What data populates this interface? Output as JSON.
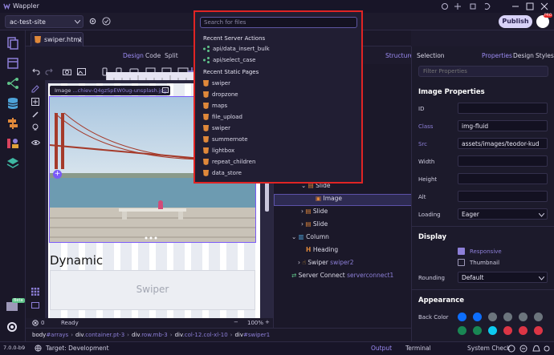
{
  "titlebar": {
    "app_name": "Wappler"
  },
  "toolbar": {
    "site": "ac-test-site",
    "publish_label": "Publish",
    "avatar_badge": "PRO"
  },
  "tabs": {
    "file_tab": "swiper.html"
  },
  "views": {
    "design": "Design",
    "code": "Code",
    "split": "Split",
    "structure": "Structure"
  },
  "image_toolbar": {
    "label": "Image",
    "file": "...chiev-Q4gzSpEW0ug-unsplash.jpg"
  },
  "canvas": {
    "heading": "Dynamic",
    "swiper_label": "Swiper"
  },
  "editor_status": {
    "errors": "0",
    "status": "Ready",
    "zoom": "100%"
  },
  "breadcrumb": [
    {
      "el": "body",
      "cls": "#arrays"
    },
    {
      "el": "div",
      "cls": ".container.pt-3"
    },
    {
      "el": "div",
      "cls": ".row.mb-3"
    },
    {
      "el": "div",
      "cls": ".col-12.col-xl-10"
    },
    {
      "el": "div",
      "cls": "#swiper1"
    }
  ],
  "structure": {
    "rows": [
      {
        "label": "Slide",
        "extra": ""
      },
      {
        "label": "Image",
        "extra": ""
      },
      {
        "label": "Slide",
        "extra": ""
      },
      {
        "label": "Slide",
        "extra": ""
      },
      {
        "label": "Column",
        "extra": ""
      },
      {
        "label": "Heading",
        "extra": ""
      },
      {
        "label": "Swiper",
        "extra": "swiper2"
      },
      {
        "label": "Server Connect",
        "extra": "serverconnect1"
      }
    ]
  },
  "right_panel": {
    "tab_selection": "Selection",
    "tab_properties": "Properties",
    "tab_design": "Design",
    "tab_styles": "Styles",
    "filter_placeholder": "Filter Properties",
    "section_image": "Image Properties",
    "labels": {
      "id": "ID",
      "class": "Class",
      "src": "Src",
      "width": "Width",
      "height": "Height",
      "alt": "Alt",
      "loading": "Loading"
    },
    "values": {
      "id": "",
      "class": "img-fluid",
      "src": "assets/images/teodor-kud",
      "width": "",
      "height": "",
      "alt": "",
      "loading": "Eager"
    },
    "section_display": "Display",
    "responsive_label": "Responsive",
    "responsive_checked": true,
    "thumbnail_label": "Thumbnail",
    "rounding_label": "Rounding",
    "rounding_value": "Default",
    "section_appearance": "Appearance",
    "back_color_label": "Back Color",
    "swatches": [
      "#0d6efd",
      "#0d6efd",
      "#6c757d",
      "#6c757d",
      "#6c757d",
      "#6c757d",
      "#198754",
      "#198754",
      "#0dcaf0",
      "#dc3545",
      "#dc3545",
      "#dc3545"
    ]
  },
  "popup": {
    "search_placeholder": "Search for files",
    "section_server": "Recent Server Actions",
    "server_actions": [
      "api/data_insert_bulk",
      "api/select_case"
    ],
    "section_pages": "Recent Static Pages",
    "pages": [
      "swiper",
      "dropzone",
      "maps",
      "file_upload",
      "swiper",
      "summernote",
      "lightbox",
      "repeat_children",
      "data_store"
    ]
  },
  "statusbar": {
    "version": "7.0.0-b9",
    "target": "Target: Development",
    "output": "Output",
    "terminal": "Terminal",
    "system_check": "System Check"
  },
  "side_badges": {
    "beta": "Beta"
  }
}
